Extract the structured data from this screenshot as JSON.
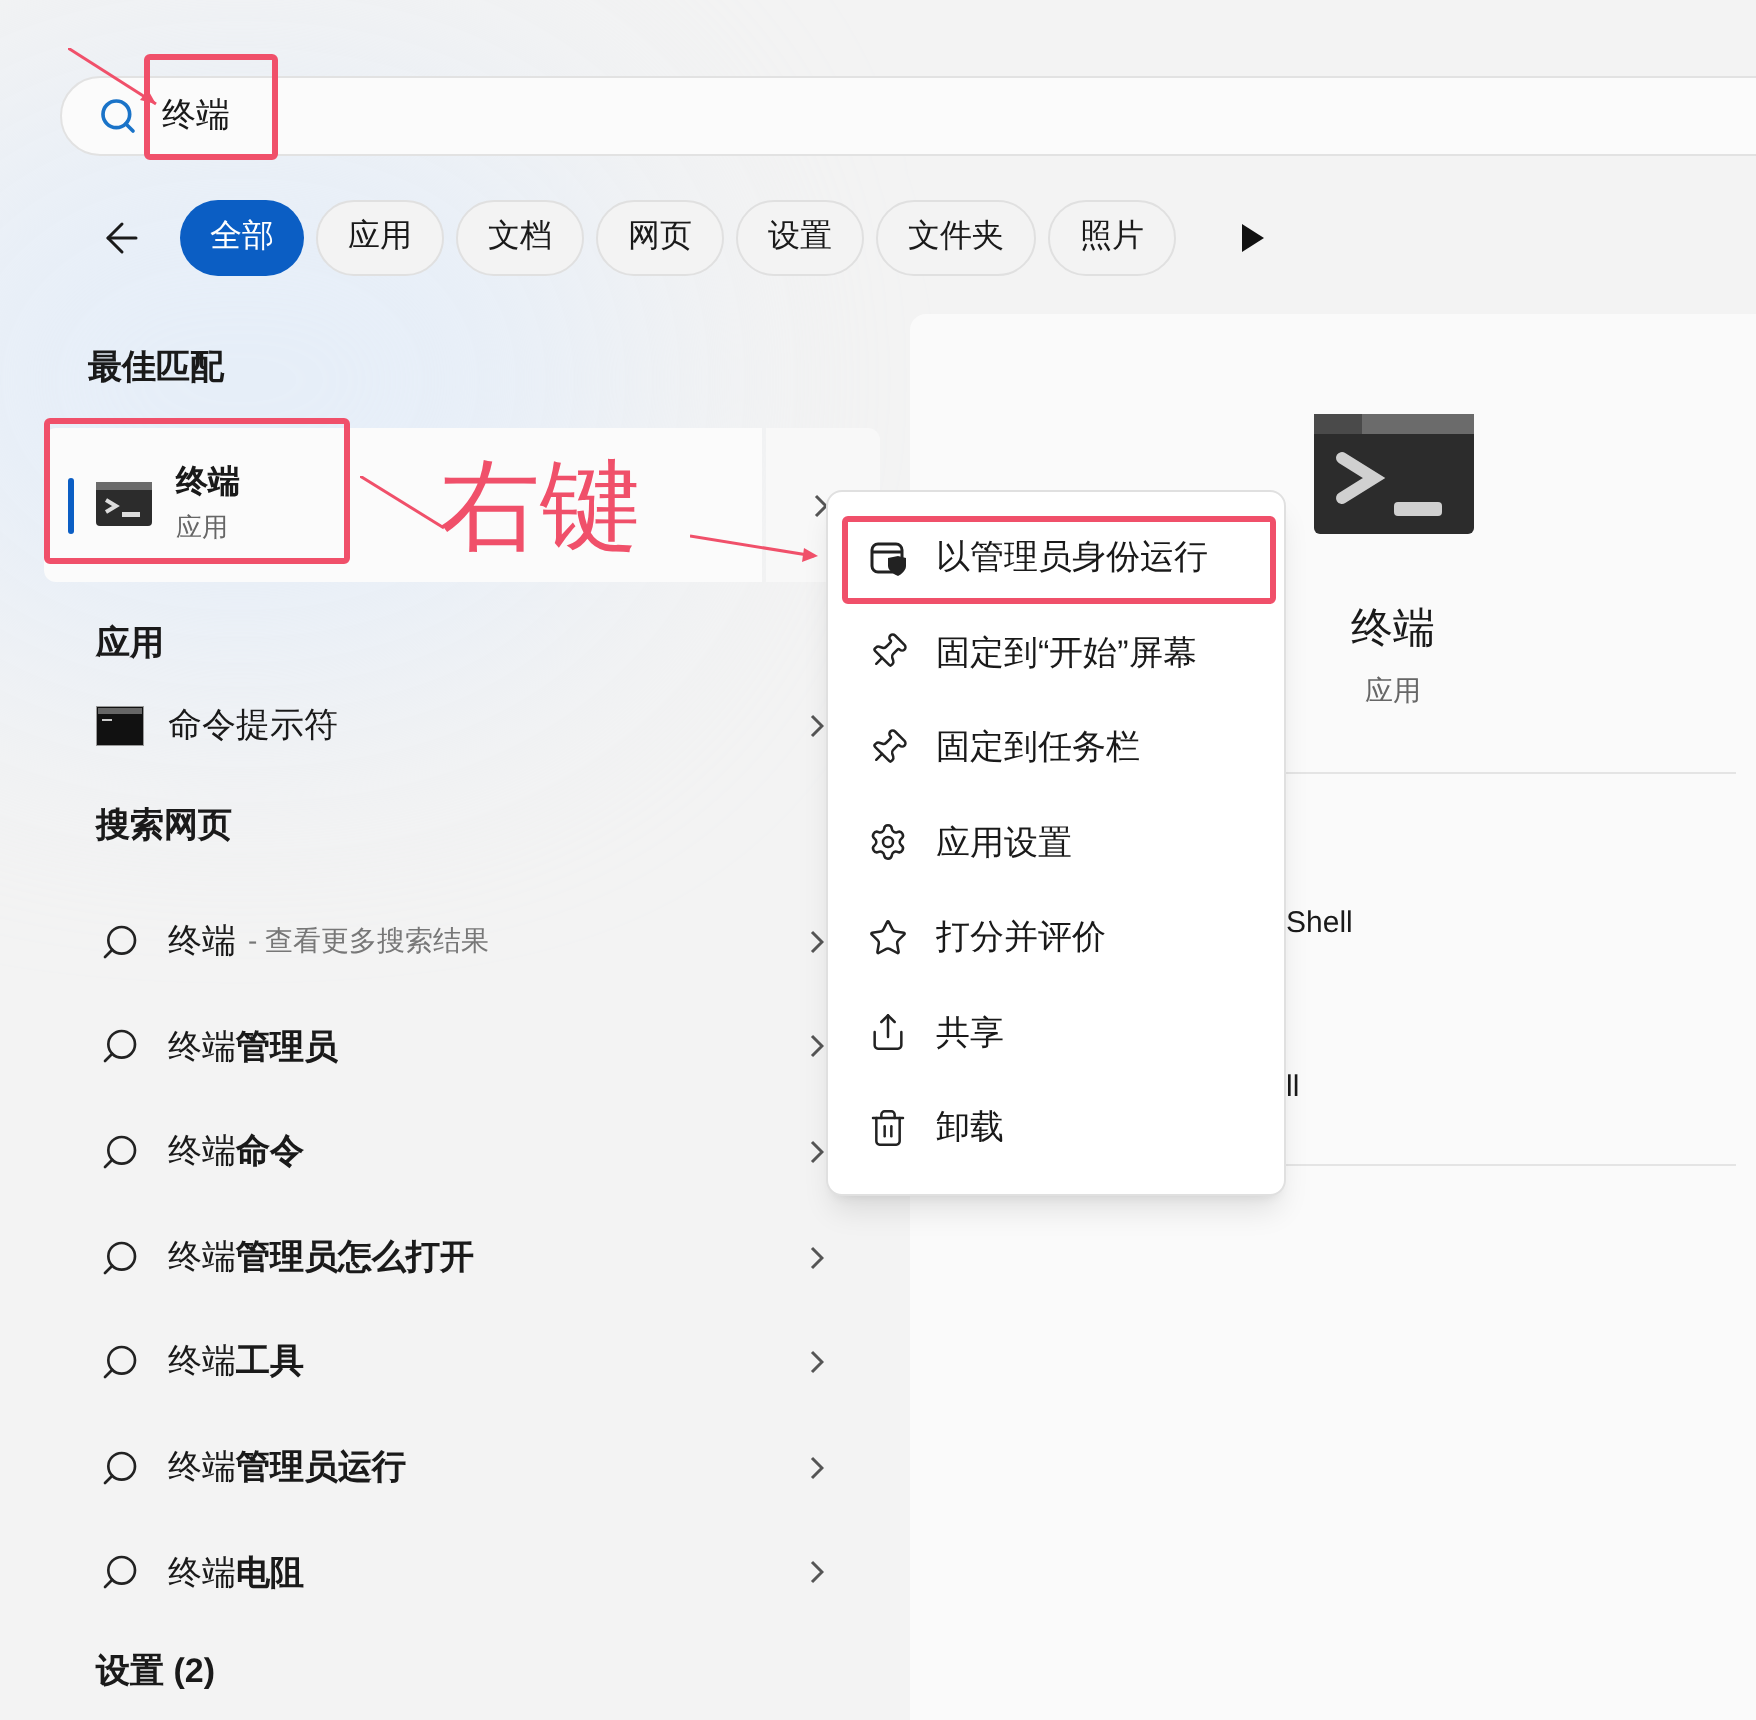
{
  "search": {
    "value": "终端"
  },
  "filters": [
    {
      "label": "全部",
      "selected": true
    },
    {
      "label": "应用",
      "selected": false
    },
    {
      "label": "文档",
      "selected": false
    },
    {
      "label": "网页",
      "selected": false
    },
    {
      "label": "设置",
      "selected": false
    },
    {
      "label": "文件夹",
      "selected": false
    },
    {
      "label": "照片",
      "selected": false
    }
  ],
  "best_match": {
    "heading": "最佳匹配",
    "title": "终端",
    "subtitle": "应用",
    "selected": true
  },
  "apps": {
    "heading": "应用",
    "items": [
      {
        "title": "命令提示符"
      }
    ]
  },
  "web": {
    "heading": "搜索网页",
    "items": [
      {
        "text": "终端",
        "hint": "- 查看更多搜索结果"
      },
      {
        "text": "终端**管理员**"
      },
      {
        "text": "终端**命令**"
      },
      {
        "text": "终端**管理员怎么打开**"
      },
      {
        "text": "终端**工具**"
      },
      {
        "text": "终端**管理员运行**"
      },
      {
        "text": "终端**电阻**"
      }
    ]
  },
  "settings": {
    "heading": "设置 (2)"
  },
  "detail": {
    "title": "终端",
    "subtitle": "应用",
    "actions": [
      "Shell",
      "ll"
    ]
  },
  "context_menu": [
    {
      "kind": "admin",
      "label": "以管理员身份运行"
    },
    {
      "kind": "pin",
      "label": "固定到“开始”屏幕"
    },
    {
      "kind": "pin",
      "label": "固定到任务栏"
    },
    {
      "kind": "settings",
      "label": "应用设置"
    },
    {
      "kind": "rate",
      "label": "打分并评价"
    },
    {
      "kind": "share",
      "label": "共享"
    },
    {
      "kind": "uninstall",
      "label": "卸载"
    }
  ],
  "annotation": {
    "label": "右键"
  }
}
